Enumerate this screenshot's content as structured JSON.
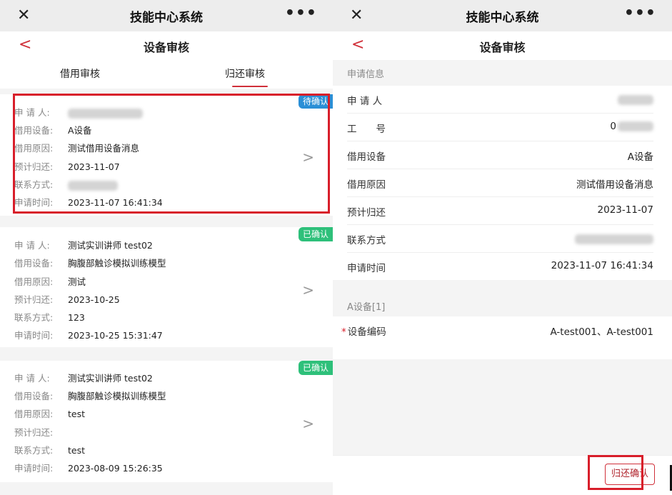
{
  "left": {
    "app_title": "技能中心系统",
    "close_glyph": "✕",
    "more_glyph": "•••",
    "back_glyph": "<",
    "page_title": "设备审核",
    "tabs": [
      {
        "label": "借用审核"
      },
      {
        "label": "归还审核"
      }
    ],
    "labels": {
      "applicant": "申 请 人:",
      "device": "借用设备:",
      "reason": "借用原因:",
      "expected_return": "预计归还:",
      "contact": "联系方式:",
      "apply_time": "申请时间:"
    },
    "chevron_glyph": ">",
    "records": [
      {
        "status": "待确认",
        "applicant": "",
        "device": "A设备",
        "reason": "测试借用设备消息",
        "expected_return": "2023-11-07",
        "contact": "",
        "apply_time": "2023-11-07 16:41:34"
      },
      {
        "status": "已确认",
        "applicant": "测试实训讲师 test02",
        "device": "胸腹部触诊模拟训练模型",
        "reason": "测试",
        "expected_return": "2023-10-25",
        "contact": "123",
        "apply_time": "2023-10-25 15:31:47"
      },
      {
        "status": "已确认",
        "applicant": "测试实训讲师 test02",
        "device": "胸腹部触诊模拟训练模型",
        "reason": "test",
        "expected_return": "",
        "contact": "test",
        "apply_time": "2023-08-09 15:26:35"
      }
    ]
  },
  "right": {
    "app_title": "技能中心系统",
    "close_glyph": "✕",
    "more_glyph": "•••",
    "back_glyph": "<",
    "page_title": "设备审核",
    "section_apply": "申请信息",
    "fields": [
      {
        "label": "申 请 人",
        "value": ""
      },
      {
        "label": "工　　号",
        "value": "0"
      },
      {
        "label": "借用设备",
        "value": "A设备"
      },
      {
        "label": "借用原因",
        "value": "测试借用设备消息"
      },
      {
        "label": "预计归还",
        "value": "2023-11-07"
      },
      {
        "label": "联系方式",
        "value": ""
      },
      {
        "label": "申请时间",
        "value": "2023-11-07 16:41:34"
      }
    ],
    "section_device": "A设备[1]",
    "required_mark": "*",
    "device_code_label": "设备编码",
    "device_code_value": "A-test001、A-test001",
    "return_confirm_label": "归还确认"
  },
  "colors": {
    "accent": "#d0303a",
    "pending": "#2b8fd6",
    "confirmed": "#2ec07a",
    "highlight": "#d81e2a"
  }
}
